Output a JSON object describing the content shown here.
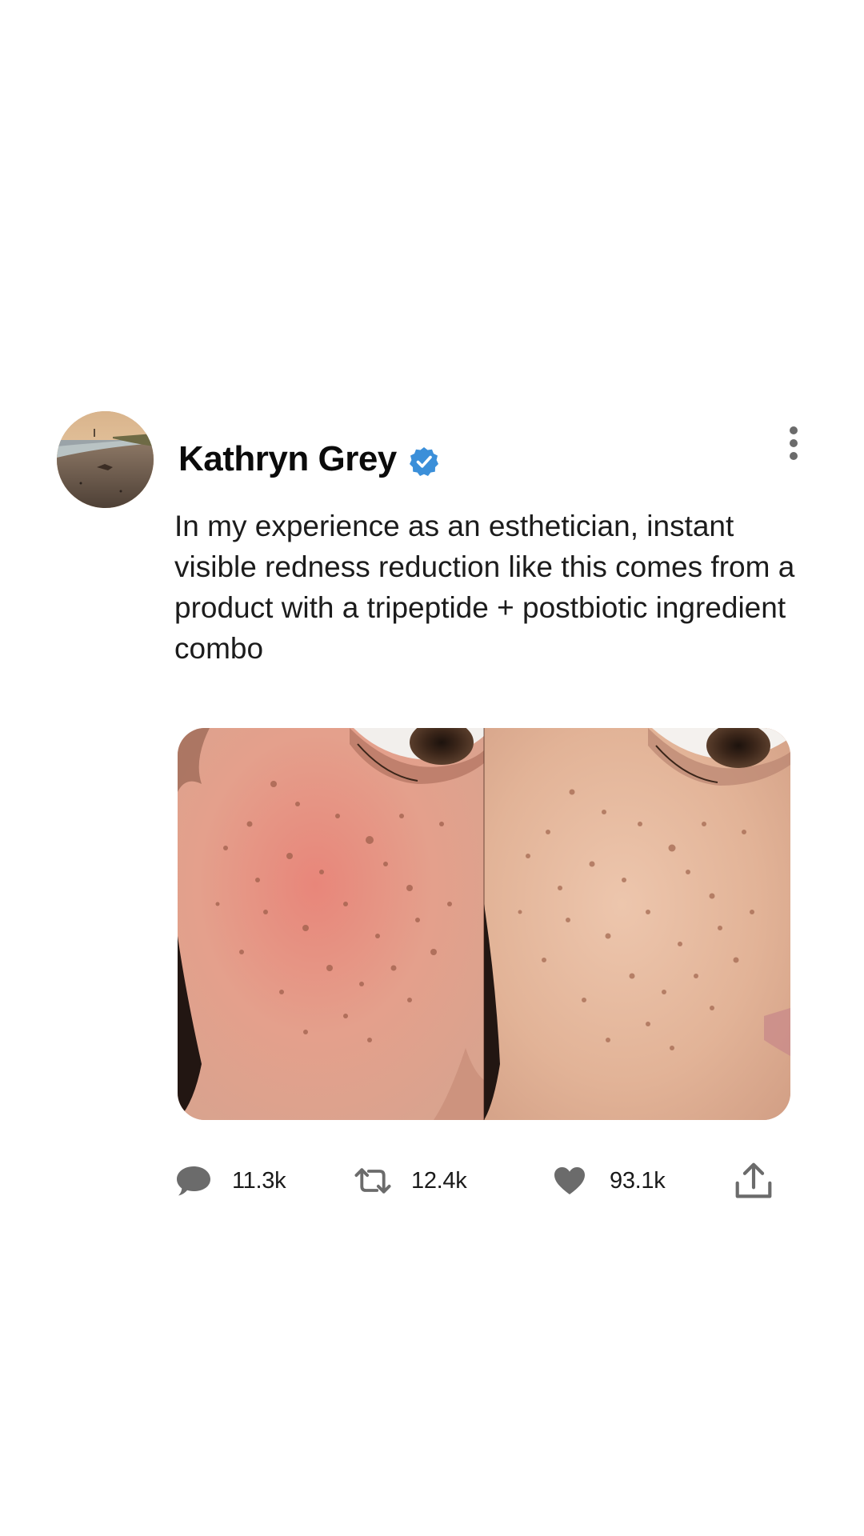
{
  "post": {
    "author": {
      "display_name": "Kathryn Grey",
      "verified": true,
      "avatar_icon": "avatar-beach-photo"
    },
    "text": "In my experience as an esthetician, instant visible redness reduction like this comes from a product with a tripeptide + postbiotic ingredient combo",
    "media": {
      "type": "before-after-photo",
      "panels": [
        "before-redness",
        "after-reduced-redness"
      ]
    },
    "stats": {
      "replies": "11.3k",
      "reposts": "12.4k",
      "likes": "93.1k"
    }
  },
  "colors": {
    "verified_badge": "#3b8fd9",
    "icon_gray": "#6b6b6b",
    "text": "#1c1c1c"
  },
  "icons": {
    "more": "more-vertical-icon",
    "reply": "comment-bubble-icon",
    "repost": "repost-arrows-icon",
    "like": "heart-icon",
    "share": "share-upload-icon"
  }
}
